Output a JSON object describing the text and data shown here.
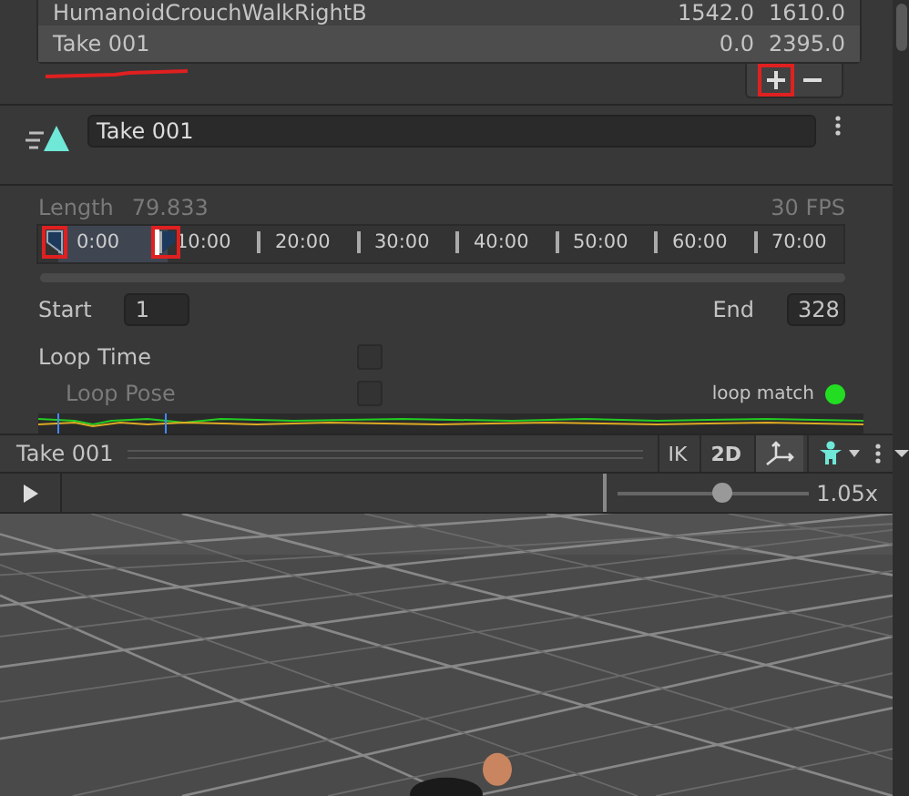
{
  "clips": [
    {
      "name": "HumanoidCrouchWalkRightB",
      "start": "1542.0",
      "end": "1610.0",
      "selected": false
    },
    {
      "name": "Take 001",
      "start": "0.0",
      "end": "2395.0",
      "selected": true
    }
  ],
  "clip_name": "Take 001",
  "length": {
    "label": "Length",
    "value": "79.833",
    "fps": "30 FPS"
  },
  "ruler": [
    "0:00",
    "10:00",
    "20:00",
    "30:00",
    "40:00",
    "50:00",
    "60:00",
    "70:00"
  ],
  "start": {
    "label": "Start",
    "value": "1"
  },
  "end": {
    "label": "End",
    "value": "328"
  },
  "loop_time": {
    "label": "Loop Time",
    "checked": false
  },
  "loop_pose": {
    "label": "Loop Pose",
    "checked": false,
    "disabled": true
  },
  "loop_match": {
    "label": "loop match",
    "color": "#22dd22"
  },
  "preview": {
    "title": "Take 001",
    "buttons": [
      "IK",
      "2D"
    ],
    "speed": "1.05x",
    "level": 0.55
  }
}
